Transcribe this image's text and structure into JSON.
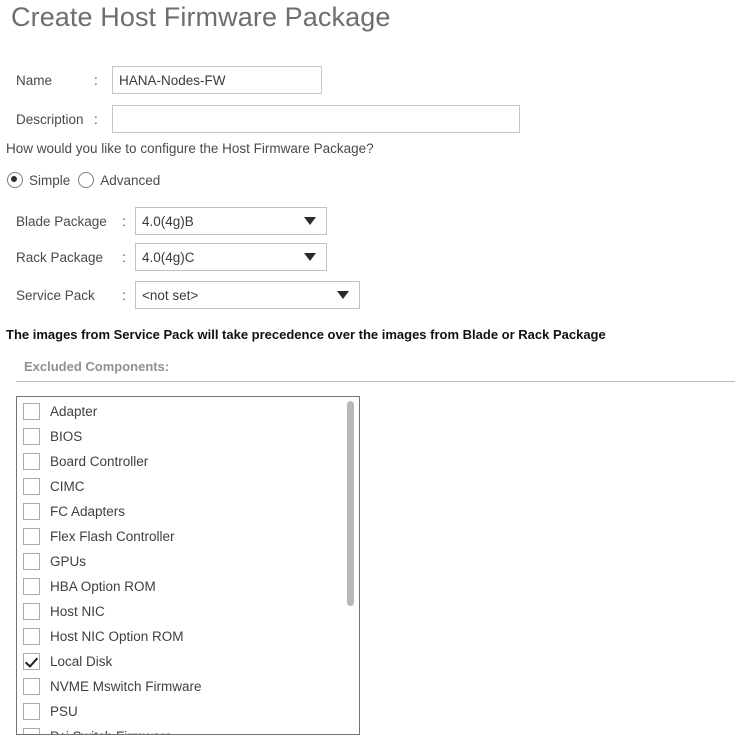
{
  "page_title": "Create Host Firmware Package",
  "form": {
    "name": {
      "label": "Name",
      "colon": ":",
      "value": "HANA-Nodes-FW",
      "placeholder": ""
    },
    "description": {
      "label": "Description",
      "colon": ":",
      "value": "",
      "placeholder": ""
    }
  },
  "question": "How would you like to configure the Host Firmware Package?",
  "mode": {
    "selected": "Simple",
    "options": [
      {
        "label": "Simple",
        "checked": true
      },
      {
        "label": "Advanced",
        "checked": false
      }
    ]
  },
  "selects": {
    "blade": {
      "label": "Blade Package",
      "colon": ":",
      "value": "4.0(4g)B",
      "icon": "chevron-down-icon"
    },
    "rack": {
      "label": "Rack Package",
      "colon": ":",
      "value": "4.0(4g)C",
      "icon": "chevron-down-icon"
    },
    "service_pack": {
      "label": "Service Pack",
      "colon": ":",
      "value": "<not set>",
      "icon": "chevron-down-icon"
    }
  },
  "notice": "The images from Service Pack will take precedence over the images from Blade or Rack Package",
  "excluded_components": {
    "section_label": "Excluded Components:",
    "items": [
      {
        "label": "Adapter",
        "checked": false
      },
      {
        "label": "BIOS",
        "checked": false
      },
      {
        "label": "Board Controller",
        "checked": false
      },
      {
        "label": "CIMC",
        "checked": false
      },
      {
        "label": "FC Adapters",
        "checked": false
      },
      {
        "label": "Flex Flash Controller",
        "checked": false
      },
      {
        "label": "GPUs",
        "checked": false
      },
      {
        "label": "HBA Option ROM",
        "checked": false
      },
      {
        "label": "Host NIC",
        "checked": false
      },
      {
        "label": "Host NIC Option ROM",
        "checked": false
      },
      {
        "label": "Local Disk",
        "checked": true
      },
      {
        "label": "NVME Mswitch Firmware",
        "checked": false
      },
      {
        "label": "PSU",
        "checked": false
      },
      {
        "label": "Pci Switch Firmware",
        "checked": false
      }
    ]
  },
  "colors": {
    "title": "#6e6e6e",
    "text": "#4a4a4a",
    "notice": "#111111",
    "section_label": "#8f9194",
    "border": "#c4c7c9",
    "list_border": "#6d7578",
    "scrollbar": "#b6b9bb"
  }
}
